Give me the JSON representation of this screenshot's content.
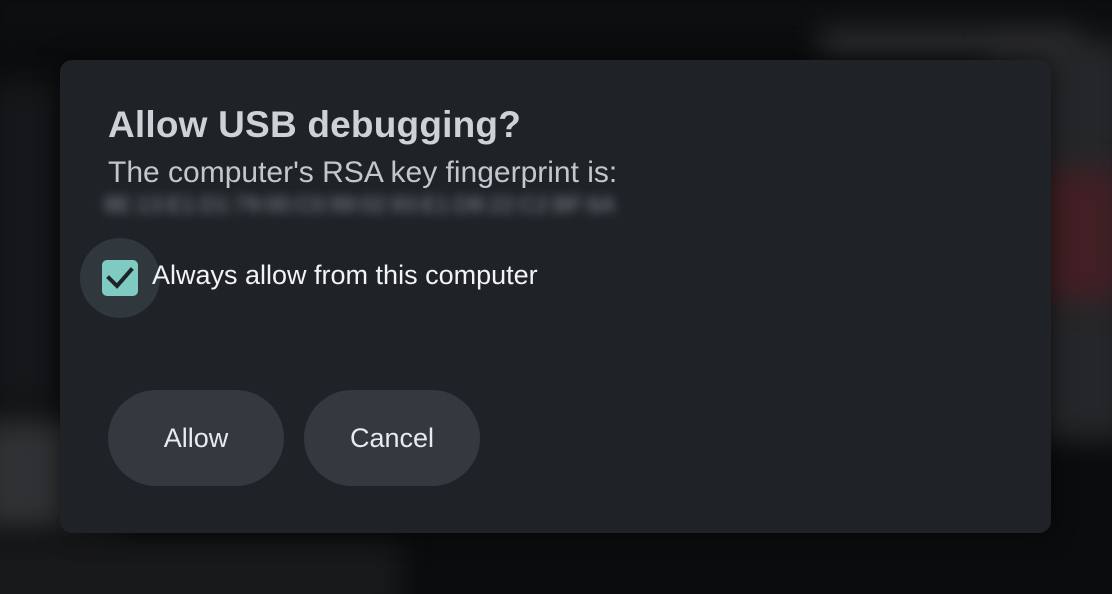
{
  "dialog": {
    "title": "Allow USB debugging?",
    "message": "The computer's RSA key fingerprint is:",
    "fingerprint": "8E:13:E1:D1:79:00:C0:99:02:93:E1:D8:22:C2:BF:6A",
    "checkbox": {
      "label": "Always allow from this computer",
      "checked": true,
      "icon": "check-icon"
    },
    "buttons": {
      "allow_label": "Allow",
      "cancel_label": "Cancel"
    }
  },
  "colors": {
    "dialog_background": "#1f2328",
    "accent": "#7fcbc2",
    "button_background": "#33393f"
  }
}
